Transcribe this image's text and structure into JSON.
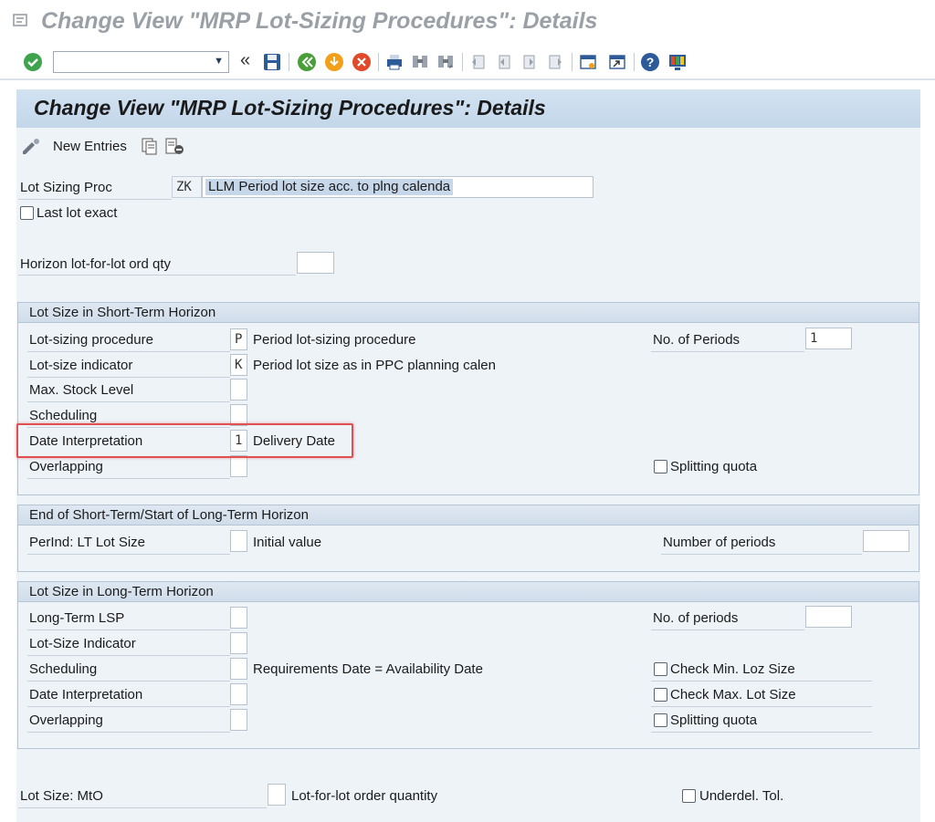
{
  "window": {
    "title": "Change View \"MRP Lot-Sizing Procedures\": Details"
  },
  "toolbar": {
    "command_field": "",
    "icons": [
      "enter-icon",
      "command-dropdown-icon",
      "collapse-icon",
      "save-icon",
      "back-icon",
      "exit-icon",
      "cancel-icon",
      "print-icon",
      "find-icon",
      "find-next-icon",
      "first-page-icon",
      "previous-page-icon",
      "next-page-icon",
      "last-page-icon",
      "create-session-icon",
      "shortcut-icon",
      "help-icon",
      "customize-layout-icon"
    ]
  },
  "header": {
    "title": "Change View \"MRP Lot-Sizing Procedures\": Details"
  },
  "actions": {
    "new_entries": "New Entries"
  },
  "top": {
    "lot_sizing_proc_label": "Lot Sizing Proc",
    "lot_sizing_proc_code": "ZK",
    "lot_sizing_proc_desc": "LLM Period lot size acc. to plng calenda",
    "last_lot_exact_label": "Last lot exact",
    "horizon_label": "Horizon  lot-for-lot ord qty",
    "horizon_value": ""
  },
  "short_term": {
    "title": "Lot Size in Short-Term Horizon",
    "lot_sizing_procedure_label": "Lot-sizing procedure",
    "lot_sizing_procedure_value": "P",
    "lot_sizing_procedure_desc": "Period lot-sizing procedure",
    "lot_size_indicator_label": "Lot-size indicator",
    "lot_size_indicator_value": "K",
    "lot_size_indicator_desc": "Period lot size as in PPC planning calen",
    "max_stock_label": "Max. Stock Level",
    "scheduling_label": "Scheduling",
    "date_interp_label": "Date Interpretation",
    "date_interp_value": "1",
    "date_interp_desc": "Delivery Date",
    "overlapping_label": "Overlapping",
    "no_periods_label": "No. of Periods",
    "no_periods_value": "1",
    "splitting_quota_label": "Splitting quota"
  },
  "transition": {
    "title": "End of Short-Term/Start of Long-Term Horizon",
    "perind_label": "PerInd: LT Lot Size",
    "perind_desc": "Initial value",
    "number_periods_label": "Number of periods"
  },
  "long_term": {
    "title": "Lot Size in Long-Term Horizon",
    "lsp_label": "Long-Term LSP",
    "indicator_label": "Lot-Size Indicator",
    "scheduling_label": "Scheduling",
    "scheduling_desc": "Requirements Date = Availability Date",
    "date_interp_label": "Date Interpretation",
    "overlapping_label": "Overlapping",
    "no_periods_label": "No. of periods",
    "check_min_label": "Check Min. Loz Size",
    "check_max_label": "Check Max. Lot Size",
    "splitting_quota_label": "Splitting quota"
  },
  "bottom": {
    "mto_label": "Lot Size: MtO",
    "mto_desc": "Lot-for-lot order quantity",
    "underdel_label": "Underdel. Tol."
  }
}
